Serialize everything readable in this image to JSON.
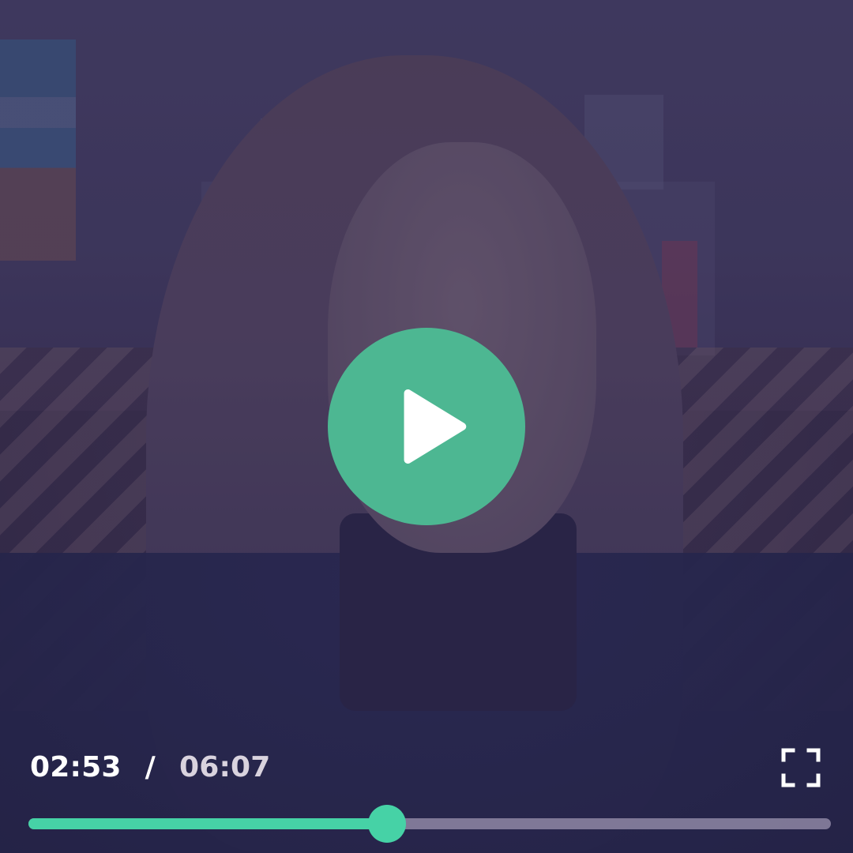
{
  "player": {
    "current_time": "02:53",
    "separator": "/",
    "duration": "06:07",
    "progress_fraction": 0.4468,
    "accent_color": "#4db792",
    "progress_color": "#46d2a6"
  },
  "icons": {
    "play": "play-icon",
    "fullscreen": "fullscreen-icon"
  }
}
